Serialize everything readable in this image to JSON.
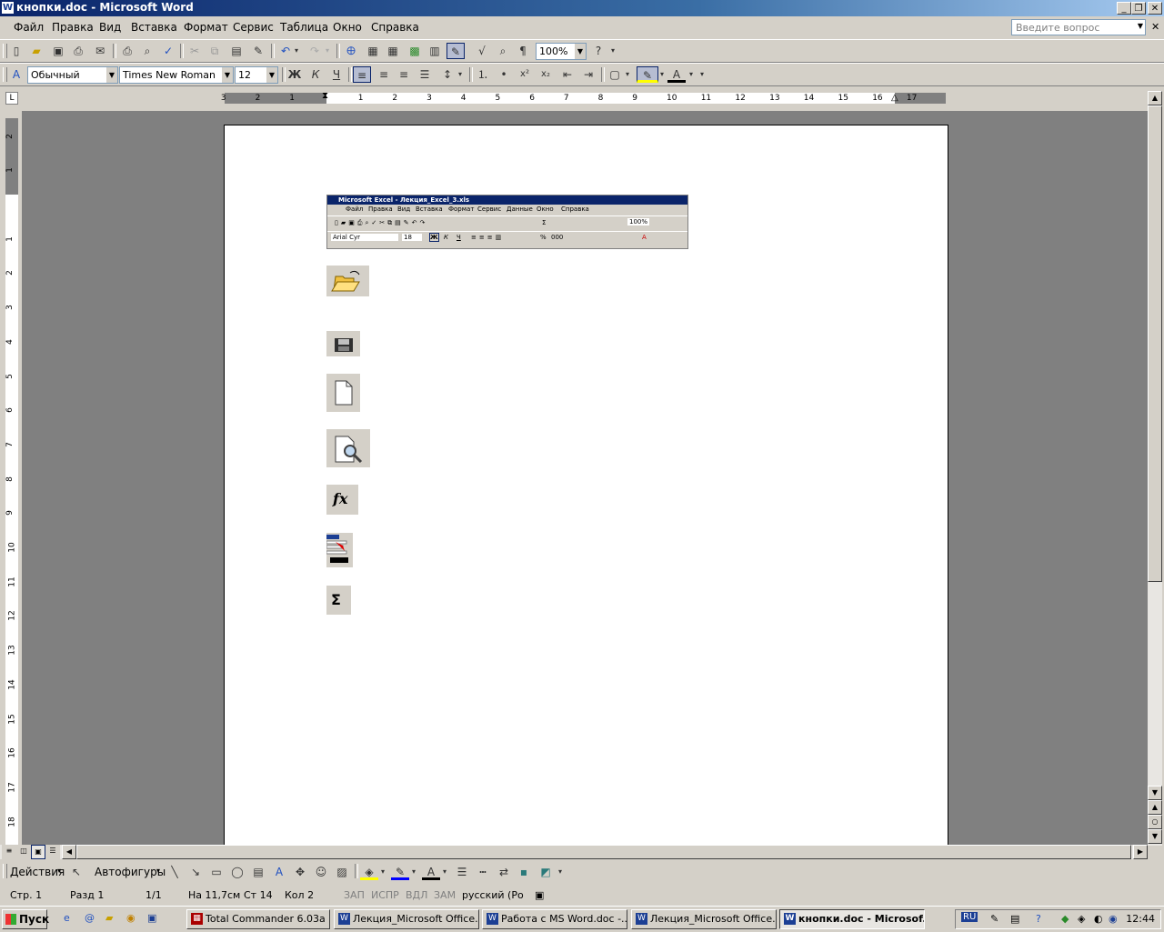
{
  "window": {
    "title": "кнопки.doc - Microsoft Word"
  },
  "menu": {
    "items": [
      "Файл",
      "Правка",
      "Вид",
      "Вставка",
      "Формат",
      "Сервис",
      "Таблица",
      "Окно",
      "Справка"
    ],
    "ask_placeholder": "Введите вопрос"
  },
  "standard_toolbar": {
    "zoom": "100%"
  },
  "formatting_toolbar": {
    "style": "Обычный",
    "font": "Times New Roman",
    "size": "12",
    "bold": "Ж",
    "italic": "К",
    "underline": "Ч"
  },
  "ruler": {
    "h_numbers": [
      "3",
      "2",
      "1",
      "1",
      "2",
      "3",
      "4",
      "5",
      "6",
      "7",
      "8",
      "9",
      "10",
      "11",
      "12",
      "13",
      "14",
      "15",
      "16",
      "17"
    ],
    "v_numbers": [
      "2",
      "1",
      "1",
      "2",
      "3",
      "4",
      "5",
      "6",
      "7",
      "8",
      "9",
      "10",
      "11",
      "12",
      "13",
      "14",
      "15",
      "16",
      "17",
      "18"
    ]
  },
  "embedded_excel": {
    "title": "Microsoft Excel - Лекция_Excel_3.xls",
    "menu": [
      "Файл",
      "Правка",
      "Вид",
      "Вставка",
      "Формат",
      "Сервис",
      "Данные",
      "Окно",
      "Справка"
    ],
    "zoom": "100%",
    "font": "Arial Cyr",
    "size": "18",
    "bold": "Ж",
    "italic": "К",
    "underline": "Ч",
    "percent": "%",
    "thousands": "000"
  },
  "page_icons": {
    "fx": "fx",
    "sigma": "Σ"
  },
  "drawing_toolbar": {
    "actions": "Действия",
    "autoshapes": "Автофигуры"
  },
  "statusbar": {
    "page": "Стр. 1",
    "section": "Разд 1",
    "pages": "1/1",
    "at": "На 11,7см",
    "line": "Ст 14",
    "col": "Кол 2",
    "rec": "ЗАП",
    "trk": "ИСПР",
    "ext": "ВДЛ",
    "ovr": "ЗАМ",
    "lang": "русский (Ро"
  },
  "taskbar": {
    "start": "Пуск",
    "tasks": [
      "Total Commander 6.03a ...",
      "Лекция_Microsoft Office...",
      "Работа с MS Word.doc -...",
      "Лекция_Microsoft Office...",
      "кнопки.doc - Microsof..."
    ],
    "lang": "RU",
    "time": "12:44"
  },
  "colors": {
    "title_bar": "#0a246a",
    "face": "#d4d0c8",
    "active_button": "#b6bdd2"
  },
  "icons": [
    "word-icon",
    "new-doc-icon",
    "open-folder-icon",
    "save-icon",
    "print-icon",
    "print-preview-icon",
    "spelling-icon",
    "cut-icon",
    "copy-icon",
    "paste-icon",
    "format-painter-icon",
    "undo-icon",
    "redo-icon",
    "hyperlink-icon",
    "tables-borders-icon",
    "insert-table-icon",
    "insert-excel-icon",
    "columns-icon",
    "drawing-icon",
    "document-map-icon",
    "show-formatting-icon",
    "help-icon",
    "style-icon",
    "align-left-icon",
    "align-center-icon",
    "align-right-icon",
    "justify-icon",
    "line-spacing-icon",
    "numbering-icon",
    "bullets-icon",
    "superscript-icon",
    "subscript-icon",
    "decrease-indent-icon",
    "increase-indent-icon",
    "border-icon",
    "highlight-icon",
    "font-color-icon",
    "sigma-icon",
    "fx-icon",
    "sort-icon"
  ]
}
